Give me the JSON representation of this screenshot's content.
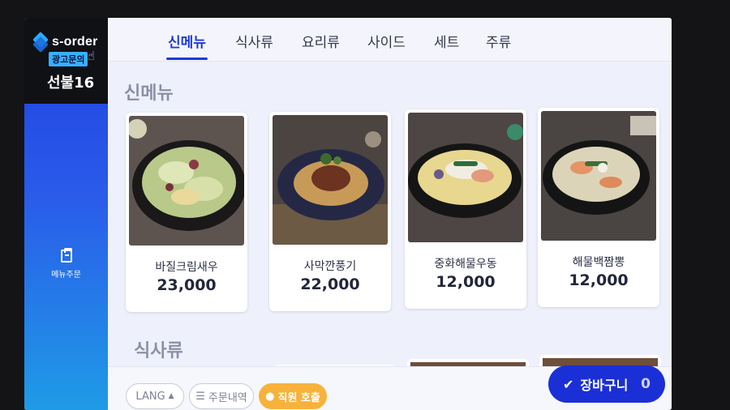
{
  "sidebar": {
    "logo_text": "s-order",
    "ad_badge": "광고문의",
    "table_label": "선불16",
    "menu_order_label": "메뉴주문"
  },
  "tabs": [
    {
      "label": "신메뉴",
      "active": true
    },
    {
      "label": "식사류"
    },
    {
      "label": "요리류"
    },
    {
      "label": "사이드"
    },
    {
      "label": "세트"
    },
    {
      "label": "주류"
    }
  ],
  "sections": [
    {
      "title": "신메뉴"
    },
    {
      "title": "식사류"
    }
  ],
  "menu_items": [
    {
      "name": "바질크림새우",
      "price": "23,000"
    },
    {
      "name": "사막깐풍기",
      "price": "22,000"
    },
    {
      "name": "중화해물우동",
      "price": "12,000"
    },
    {
      "name": "해물백짬뽕",
      "price": "12,000"
    }
  ],
  "bottom_bar": {
    "lang_label": "LANG",
    "order_history_label": "주문내역",
    "staff_call_label": "직원 호출",
    "cart_label": "장바구니",
    "cart_count": "0"
  },
  "colors": {
    "accent": "#1d3ad6",
    "cart": "#1b2fd6",
    "staff_call": "#f7b23b",
    "sidebar_top": "#1f3fe0",
    "sidebar_bottom": "#1f9be6"
  },
  "icons": [
    "logo-icon",
    "pointer-hand-icon",
    "clipboard-icon",
    "close-icon",
    "menu-lines-icon",
    "bell-icon",
    "check-icon"
  ]
}
